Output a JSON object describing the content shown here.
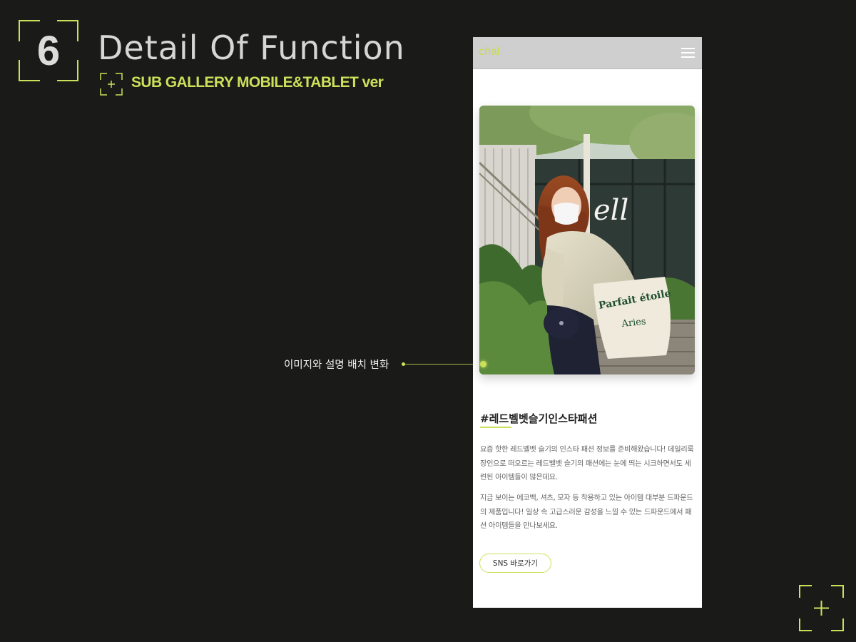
{
  "section": {
    "number": "6",
    "title": "Detail Of Function",
    "subtitle": "SUB GALLERY MOBILE&TABLET ver"
  },
  "annotation": {
    "text": "이미지와 설명 배치 변화"
  },
  "mobile": {
    "logo": "chal",
    "menu_icon": "hamburger-menu-icon",
    "photo_description_icon": "photo",
    "hashtag": "#레드벨벳슬기인스타패션",
    "paragraph1": "요즘 핫한 레드벨벳 슬기의 인스타 패션 정보를 준비해왔습니다! 데일리룩 장인으로 떠오르는 레드벨벳 슬기의 패션에는 눈에 띄는 시크하면서도 세련된 아이템들이 많은데요.",
    "paragraph2": "지금 보이는 에코백, 셔츠, 모자 등 착용하고 있는 아이템 대부분 드파운드의 제품입니다! 일상 속 고급스러운 감성을 느낄 수 있는 드파운드에서 패션 아이템들을 만나보세요.",
    "sns_button": "SNS 바로가기",
    "bag_text_1": "Parfait étoile",
    "bag_text_2": "Aries",
    "wall_text": "ell"
  },
  "colors": {
    "accent": "#cde05a",
    "background": "#1a1a18",
    "title_text": "#d6d6d6"
  }
}
